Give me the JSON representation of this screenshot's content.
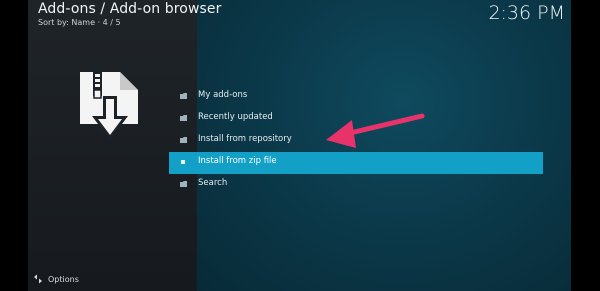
{
  "header": {
    "title": "Add-ons / Add-on browser",
    "subtitle": "Sort by: Name  ·  4 / 5",
    "clock": "2:36 PM"
  },
  "menu": {
    "items": [
      {
        "label": "My add-ons",
        "icon": "folder-icon",
        "selected": false
      },
      {
        "label": "Recently updated",
        "icon": "folder-icon",
        "selected": false
      },
      {
        "label": "Install from repository",
        "icon": "folder-icon",
        "selected": false
      },
      {
        "label": "Install from zip file",
        "icon": "bullet-icon",
        "selected": true
      },
      {
        "label": "Search",
        "icon": "folder-icon",
        "selected": false
      }
    ]
  },
  "footer": {
    "options_label": "Options",
    "options_icon": "settings-icon"
  },
  "side_icon": "zip-download-icon",
  "annotation": {
    "icon": "pointer-arrow-icon",
    "color": "#e8336a"
  },
  "colors": {
    "selection": "#12a0c6",
    "background": "#0b3a4b",
    "sidebar": "#1c2228"
  }
}
